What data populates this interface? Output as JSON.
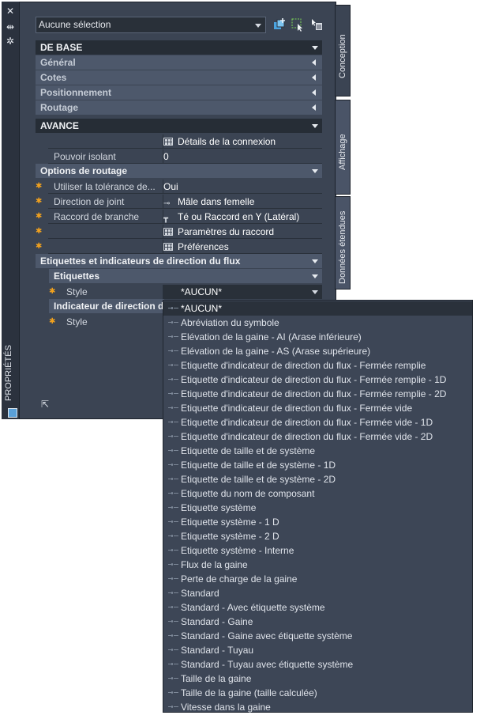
{
  "palette": {
    "vertical_title": "PROPRIÉTÉS",
    "selection": "Aucune sélection",
    "tabs": [
      "Conception",
      "Affichage",
      "Données étendues"
    ]
  },
  "sections": {
    "base": "DE BASE",
    "general": "Général",
    "cotes": "Cotes",
    "positionnement": "Positionnement",
    "routage": "Routage",
    "avance": "AVANCE",
    "options_routage": "Options de routage",
    "etiquettes_indicateurs": "Etiquettes et indicateurs de direction du flux",
    "etiquettes": "Etiquettes",
    "indicateur": "Indicateur de direction d"
  },
  "properties": {
    "details_connexion": "Détails de la connexion",
    "pouvoir_isolant": {
      "name": "Pouvoir isolant",
      "value": "0"
    },
    "tolerance": {
      "name": "Utiliser la tolérance de...",
      "value": "Oui"
    },
    "direction_joint": {
      "name": "Direction de joint",
      "value": "Mâle dans femelle"
    },
    "raccord_branche": {
      "name": "Raccord de branche",
      "value": "Té ou Raccord en Y (Latéral)"
    },
    "parametres_raccord": "Paramètres du raccord",
    "preferences": "Préférences",
    "style_label": "Style",
    "style_value": "*AUCUN*",
    "style2_label": "Style"
  },
  "dropdown": {
    "items": [
      "*AUCUN*",
      "Abréviation du symbole",
      "Elévation de la gaine - AI (Arase inférieure)",
      "Elévation de la gaine - AS (Arase supérieure)",
      "Etiquette d'indicateur de direction du flux - Fermée remplie",
      "Etiquette d'indicateur de direction du flux - Fermée remplie - 1D",
      "Etiquette d'indicateur de direction du flux - Fermée remplie - 2D",
      "Etiquette d'indicateur de direction du flux - Fermée vide",
      "Etiquette d'indicateur de direction du flux - Fermée vide - 1D",
      "Etiquette d'indicateur de direction du flux - Fermée vide - 2D",
      "Etiquette de taille et de système",
      "Etiquette de taille et de système - 1D",
      "Etiquette de taille et de système - 2D",
      "Etiquette du nom de composant",
      "Etiquette système",
      "Etiquette système - 1 D",
      "Etiquette système - 2 D",
      "Etiquette système - Interne",
      "Flux de la gaine",
      "Perte de charge de la gaine",
      "Standard",
      "Standard - Avec étiquette système",
      "Standard - Gaine",
      "Standard - Gaine avec étiquette système",
      "Standard - Tuyau",
      "Standard - Tuyau avec étiquette système",
      "Taille de la gaine",
      "Taille de la gaine (taille calculée)",
      "Vitesse dans la gaine"
    ]
  },
  "colors": {
    "accent_star": "#f2a21e",
    "panel_bg": "#3b4453",
    "dropdown_bg": "#3d4656"
  }
}
